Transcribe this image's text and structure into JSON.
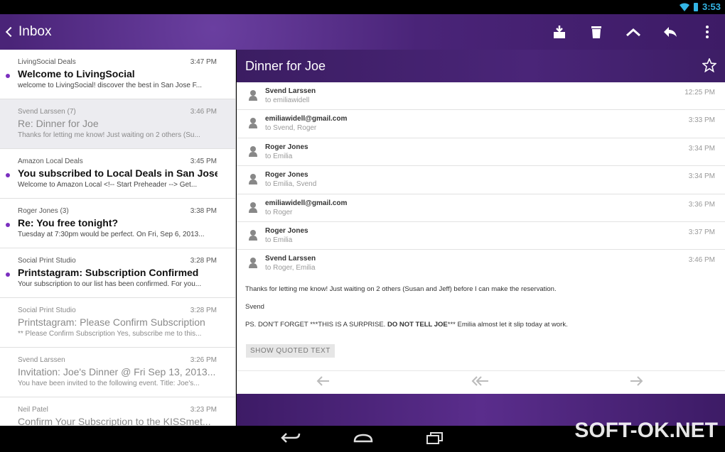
{
  "status": {
    "time": "3:53"
  },
  "appbar": {
    "back_label": "Inbox",
    "actions": [
      "archive-icon",
      "delete-icon",
      "collapse-icon",
      "reply-icon",
      "overflow-menu-icon"
    ]
  },
  "inbox": [
    {
      "from": "LivingSocial Deals",
      "time": "3:47 PM",
      "subject": "Welcome to LivingSocial",
      "snippet": "welcome to LivingSocial! discover the best in San Jose F...",
      "unread": true,
      "selected": false
    },
    {
      "from": "Svend Larssen (7)",
      "time": "3:46 PM",
      "subject": "Re: Dinner for Joe",
      "snippet": "Thanks for letting me know! Just waiting on 2 others (Su...",
      "unread": false,
      "selected": true
    },
    {
      "from": "Amazon Local Deals",
      "time": "3:45 PM",
      "subject": "You subscribed to Local Deals in San Jose",
      "snippet": "Welcome to Amazon Local <!-- Start Preheader --> Get...",
      "unread": true,
      "selected": false
    },
    {
      "from": "Roger Jones (3)",
      "time": "3:38 PM",
      "subject": "Re: You free tonight?",
      "snippet": "Tuesday at 7:30pm would be perfect. On Fri, Sep 6, 2013...",
      "unread": true,
      "selected": false
    },
    {
      "from": "Social Print Studio",
      "time": "3:28 PM",
      "subject": "Printstagram: Subscription Confirmed",
      "snippet": "Your subscription to our list has been confirmed. For you...",
      "unread": true,
      "selected": false
    },
    {
      "from": "Social Print Studio",
      "time": "3:28 PM",
      "subject": "Printstagram: Please Confirm Subscription",
      "snippet": "** Please Confirm Subscription Yes, subscribe me to this...",
      "unread": false,
      "selected": false
    },
    {
      "from": "Svend Larssen",
      "time": "3:26 PM",
      "subject": "Invitation: Joe's Dinner @ Fri Sep 13, 2013...",
      "snippet": "You have been invited to the following event. Title: Joe's...",
      "unread": false,
      "selected": false
    },
    {
      "from": "Neil Patel",
      "time": "3:23 PM",
      "subject": "Confirm Your Subscription to the KISSmet...",
      "snippet": "",
      "unread": false,
      "selected": false
    }
  ],
  "conversation": {
    "title": "Dinner for Joe",
    "messages": [
      {
        "from": "Svend Larssen",
        "to": "to emiliawidell",
        "time": "12:25 PM"
      },
      {
        "from": "emiliawidell@gmail.com",
        "to": "to Svend, Roger",
        "time": "3:33 PM"
      },
      {
        "from": "Roger Jones",
        "to": "to Emilia",
        "time": "3:34 PM"
      },
      {
        "from": "Roger Jones",
        "to": "to Emilia, Svend",
        "time": "3:34 PM"
      },
      {
        "from": "emiliawidell@gmail.com",
        "to": "to Roger",
        "time": "3:36 PM"
      },
      {
        "from": "Roger Jones",
        "to": "to Emilia",
        "time": "3:37 PM"
      },
      {
        "from": "Svend Larssen",
        "to": "to Roger, Emilia",
        "time": "3:46 PM"
      }
    ],
    "body_line1": "Thanks for letting me know! Just waiting on 2 others (Susan and Jeff) before I can make the reservation.",
    "body_sign": "Svend",
    "body_ps_prefix": "PS. DON'T FORGET ***THIS IS A SURPRISE.",
    "body_ps_bold": "DO NOT TELL JOE",
    "body_ps_suffix": "*** Emilia almost let it slip today at work.",
    "show_quoted": "SHOW QUOTED TEXT"
  },
  "watermark": "SOFT-OK.NET"
}
